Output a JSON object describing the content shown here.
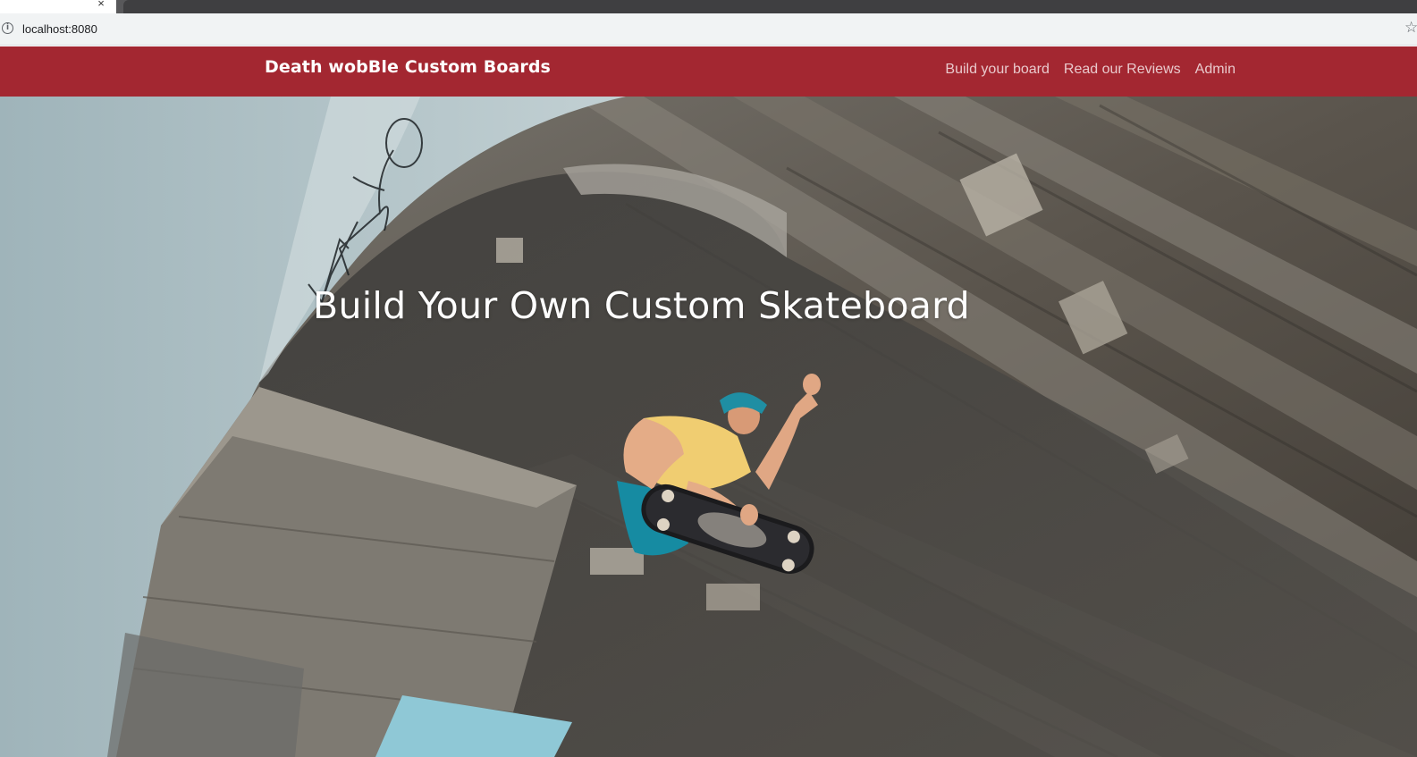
{
  "browser": {
    "tab_close_glyph": "×",
    "url": "localhost:8080",
    "info_icon": "info-icon",
    "bookmark_icon": "star-icon"
  },
  "site": {
    "brand": "Death wobBle Custom Boards",
    "nav": [
      {
        "label": "Build your board"
      },
      {
        "label": "Read our Reviews"
      },
      {
        "label": "Admin"
      }
    ]
  },
  "hero": {
    "title": "Build Your Own Custom Skateboard"
  },
  "colors": {
    "navbar": "#a32731",
    "nav_link": "#e9c9cc",
    "brand_text": "#ffffff"
  }
}
